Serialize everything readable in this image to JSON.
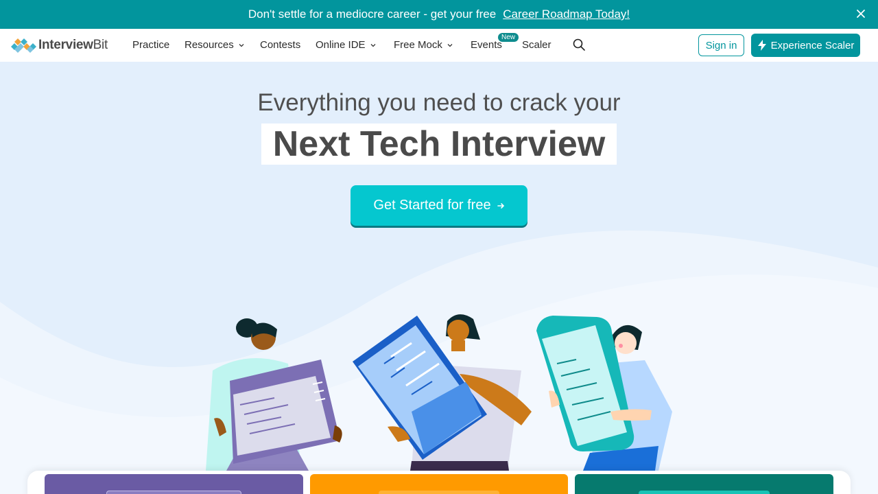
{
  "banner": {
    "text": "Don't settle for a mediocre career - get your free",
    "link": "Career Roadmap Today!",
    "close_icon": "close-icon",
    "bg_color": "#02959d"
  },
  "nav": {
    "logo": {
      "part1": "Interview",
      "part2": "Bit"
    },
    "items": [
      {
        "label": "Practice"
      },
      {
        "label": "Resources"
      },
      {
        "label": "Contests"
      },
      {
        "label": "Online IDE"
      },
      {
        "label": "Free Mock"
      },
      {
        "label": "Events"
      },
      {
        "label": "Scaler"
      }
    ],
    "new_badge": "New",
    "search_icon": "search-icon",
    "signin": "Sign in",
    "experience": "Experience Scaler"
  },
  "hero": {
    "headline": "Everything you need to crack your",
    "title": "Next Tech Interview",
    "cta": "Get Started for free"
  },
  "colors": {
    "accent": "#02959d",
    "cta": "#05c7cf",
    "card1": "#6a5ba4",
    "card2": "#ff9a00",
    "card3": "#067a6e"
  }
}
